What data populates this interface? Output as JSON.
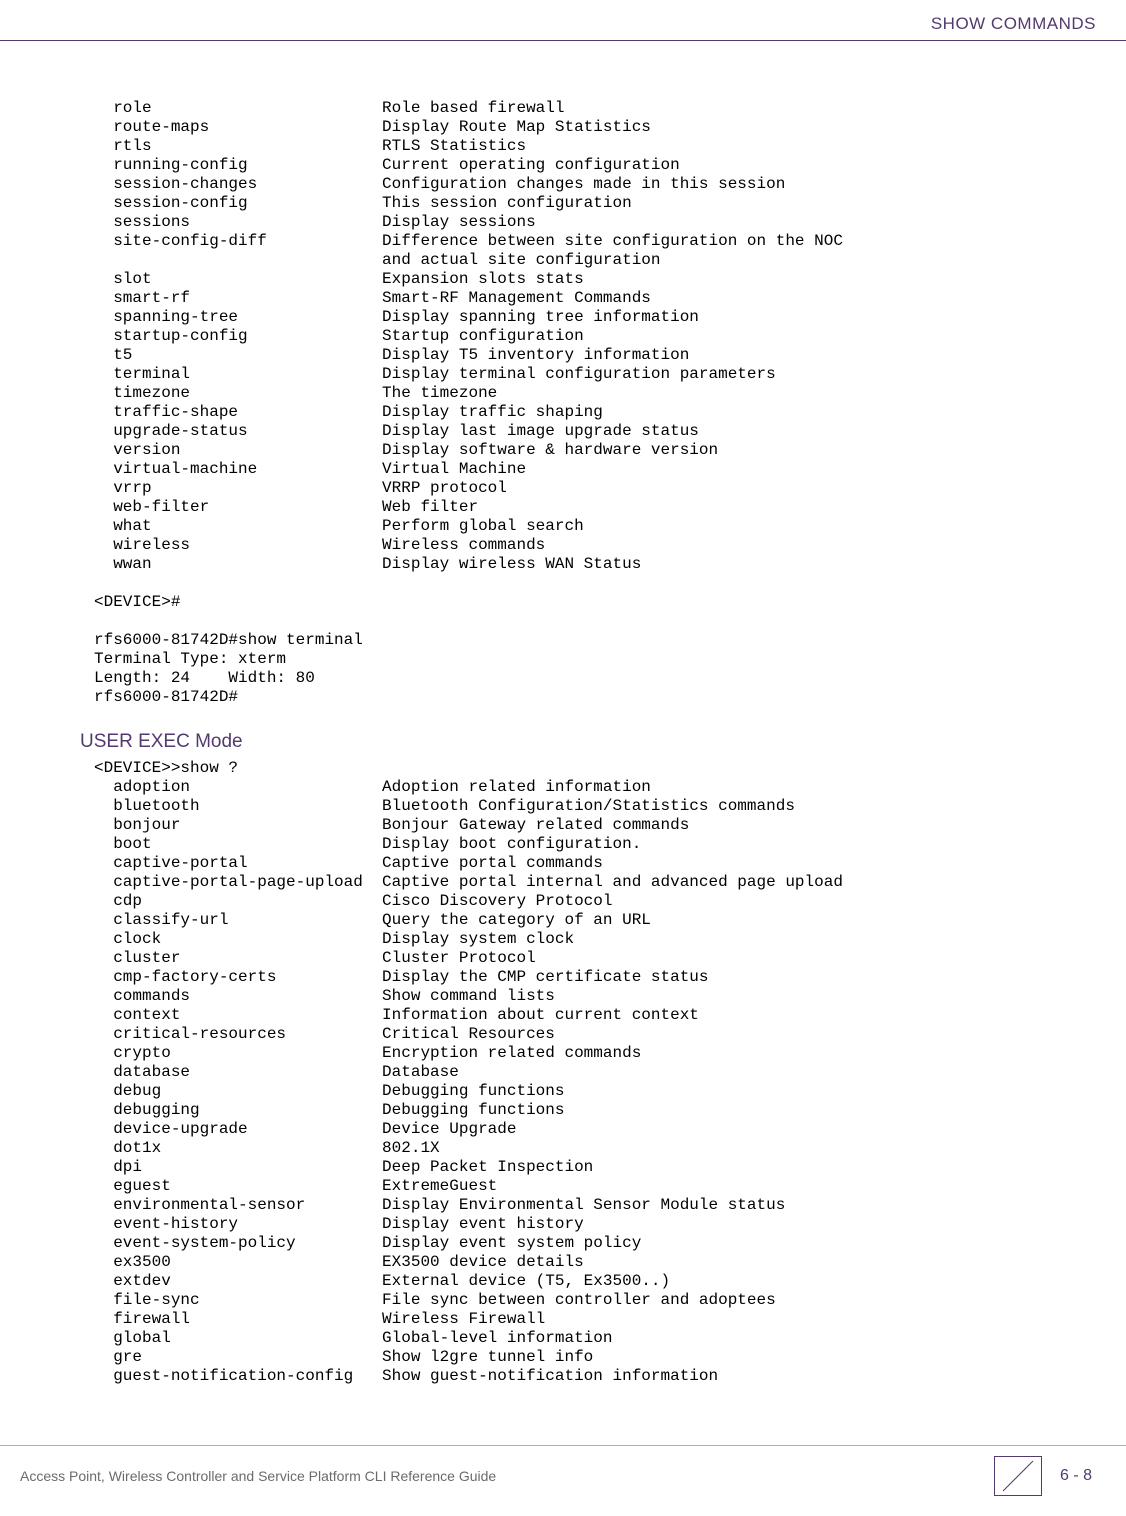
{
  "header": {
    "title": "SHOW COMMANDS"
  },
  "block1": "  role                        Role based firewall\n  route-maps                  Display Route Map Statistics\n  rtls                        RTLS Statistics\n  running-config              Current operating configuration\n  session-changes             Configuration changes made in this session\n  session-config              This session configuration\n  sessions                    Display sessions\n  site-config-diff            Difference between site configuration on the NOC\n                              and actual site configuration\n  slot                        Expansion slots stats\n  smart-rf                    Smart-RF Management Commands\n  spanning-tree               Display spanning tree information\n  startup-config              Startup configuration\n  t5                          Display T5 inventory information\n  terminal                    Display terminal configuration parameters\n  timezone                    The timezone\n  traffic-shape               Display traffic shaping\n  upgrade-status              Display last image upgrade status\n  version                     Display software & hardware version\n  virtual-machine             Virtual Machine\n  vrrp                        VRRP protocol\n  web-filter                  Web filter\n  what                        Perform global search\n  wireless                    Wireless commands\n  wwan                        Display wireless WAN Status\n\n<DEVICE>#\n\nrfs6000-81742D#show terminal\nTerminal Type: xterm\nLength: 24    Width: 80\nrfs6000-81742D#",
  "section": {
    "heading": "USER EXEC Mode"
  },
  "block2": "<DEVICE>>show ?\n  adoption                    Adoption related information\n  bluetooth                   Bluetooth Configuration/Statistics commands\n  bonjour                     Bonjour Gateway related commands\n  boot                        Display boot configuration.\n  captive-portal              Captive portal commands\n  captive-portal-page-upload  Captive portal internal and advanced page upload\n  cdp                         Cisco Discovery Protocol\n  classify-url                Query the category of an URL\n  clock                       Display system clock\n  cluster                     Cluster Protocol\n  cmp-factory-certs           Display the CMP certificate status\n  commands                    Show command lists\n  context                     Information about current context\n  critical-resources          Critical Resources\n  crypto                      Encryption related commands\n  database                    Database\n  debug                       Debugging functions\n  debugging                   Debugging functions\n  device-upgrade              Device Upgrade\n  dot1x                       802.1X\n  dpi                         Deep Packet Inspection\n  eguest                      ExtremeGuest\n  environmental-sensor        Display Environmental Sensor Module status\n  event-history               Display event history\n  event-system-policy         Display event system policy\n  ex3500                      EX3500 device details\n  extdev                      External device (T5, Ex3500..)\n  file-sync                   File sync between controller and adoptees\n  firewall                    Wireless Firewall\n  global                      Global-level information\n  gre                         Show l2gre tunnel info\n  guest-notification-config   Show guest-notification information",
  "footer": {
    "left": "Access Point, Wireless Controller and Service Platform CLI Reference Guide",
    "page": "6 - 8"
  }
}
